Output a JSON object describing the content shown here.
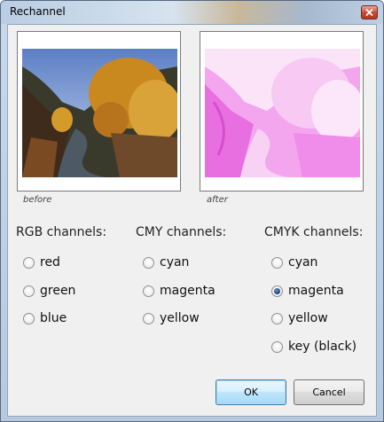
{
  "window": {
    "title": "Rechannel"
  },
  "previews": {
    "before_caption": "before",
    "after_caption": "after"
  },
  "groups": {
    "rgb": {
      "title": "RGB channels:",
      "options": [
        "red",
        "green",
        "blue"
      ],
      "selected": null
    },
    "cmy": {
      "title": "CMY channels:",
      "options": [
        "cyan",
        "magenta",
        "yellow"
      ],
      "selected": null
    },
    "cmyk": {
      "title": "CMYK channels:",
      "options": [
        "cyan",
        "magenta",
        "yellow",
        "key (black)"
      ],
      "selected": "magenta"
    }
  },
  "buttons": {
    "ok": "OK",
    "cancel": "Cancel"
  },
  "icons": {
    "close": "close-icon"
  },
  "colors": {
    "accent": "#3c7fb1",
    "after_tint": "#f07ee8"
  }
}
